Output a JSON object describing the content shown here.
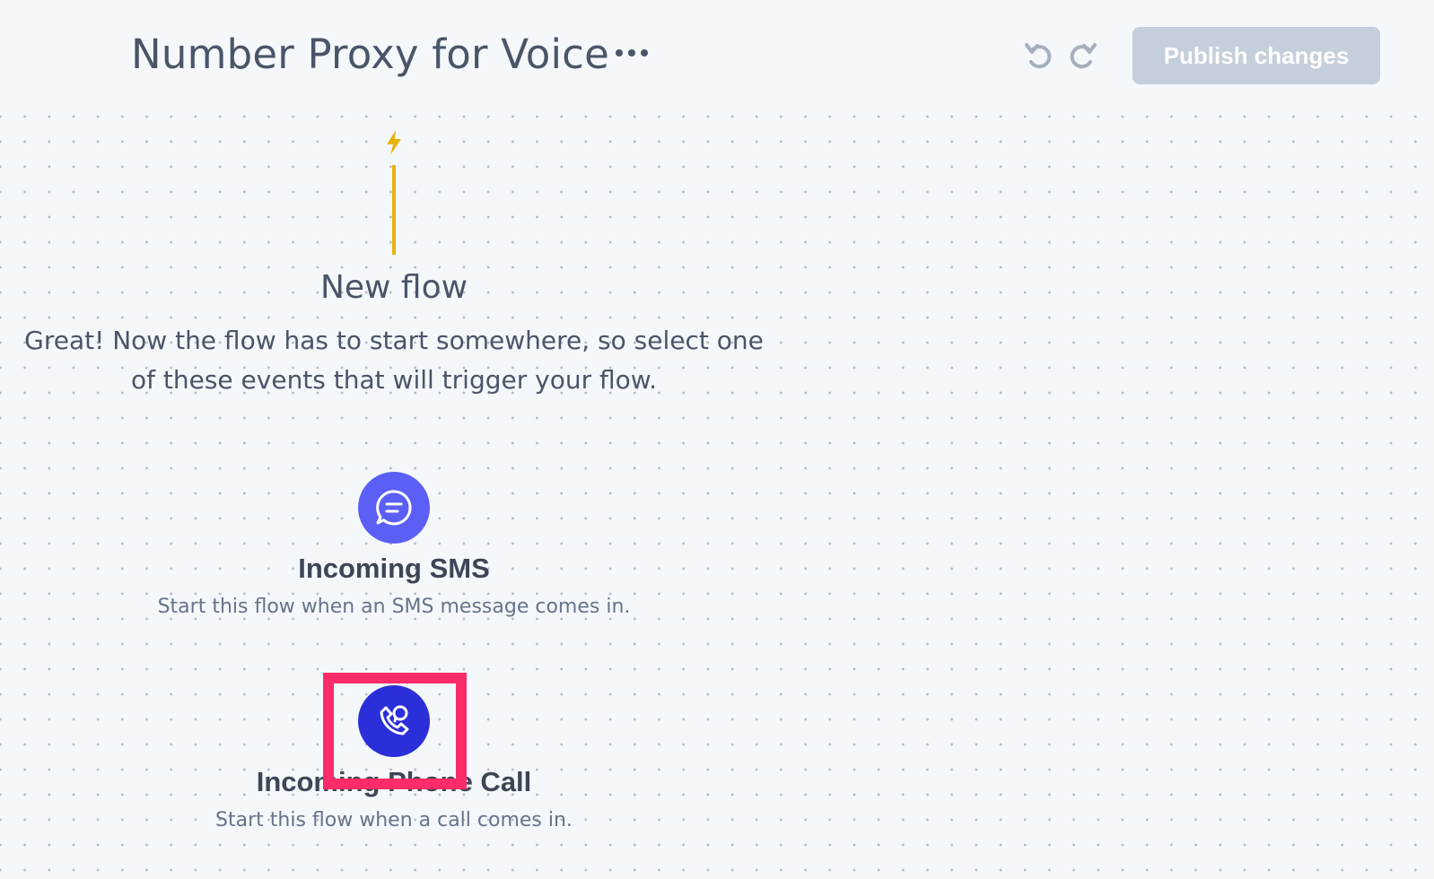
{
  "header": {
    "title": "Number Proxy for Voice",
    "more_icon": "more-horizontal-icon",
    "undo_icon": "undo-icon",
    "redo_icon": "redo-icon",
    "publish_label": "Publish changes"
  },
  "flow": {
    "trigger_icon": "lightning-bolt-icon",
    "title": "New flow",
    "description": "Great! Now the flow has to start somewhere, so select one of these events that will trigger your flow."
  },
  "triggers": [
    {
      "icon": "chat-bubble-icon",
      "title": "Incoming SMS",
      "description": "Start this flow when an SMS message comes in."
    },
    {
      "icon": "phone-call-icon",
      "title": "Incoming Phone Call",
      "description": "Start this flow when a call comes in."
    }
  ],
  "colors": {
    "background": "#f5f8fb",
    "accent_bolt": "#e9b411",
    "sms_icon_bg": "#5b5ff5",
    "call_icon_bg": "#2b2fd9",
    "publish_disabled": "#c5cfdb",
    "highlight": "#fb2c69"
  }
}
